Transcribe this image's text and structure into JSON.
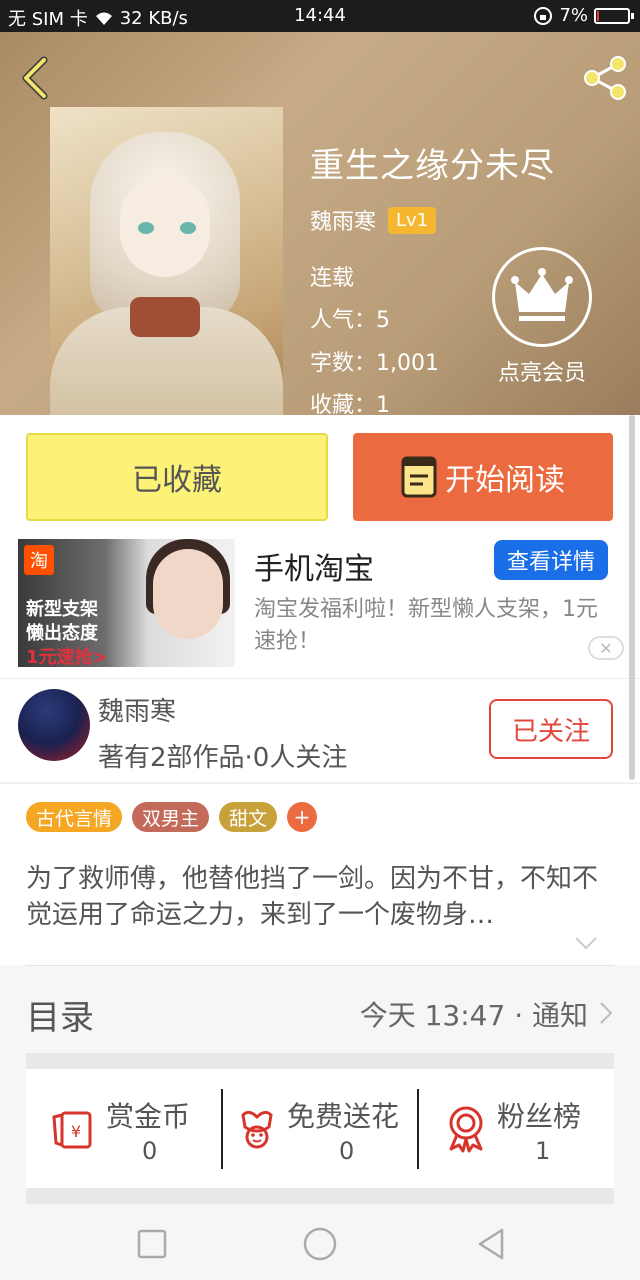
{
  "status_bar": {
    "carrier": "无 SIM 卡",
    "speed": "32 KB/s",
    "time": "14:44",
    "battery": "7%",
    "battery_level": 0.07
  },
  "book": {
    "title": "重生之缘分未尽",
    "author": "魏雨寒",
    "level": "Lv1",
    "status": "连载",
    "popularity": "人气：5",
    "word_count": "字数：1,001",
    "favorites": "收藏：1"
  },
  "vip": {
    "label": "点亮会员"
  },
  "actions": {
    "favorited_label": "已收藏",
    "read_label": "开始阅读"
  },
  "ad": {
    "title": "手机淘宝",
    "detail_button": "查看详情",
    "description": "淘宝发福利啦！新型懒人支架，1元速抢！",
    "image_logo": "淘",
    "image_text_1": "新型支架",
    "image_text_2": "懒出态度",
    "image_text_3": "1元速抢>"
  },
  "author_card": {
    "name": "魏雨寒",
    "info": "著有2部作品·0人关注",
    "follow_label": "已关注"
  },
  "tags": [
    {
      "label": "古代言情",
      "color": "#f5a623"
    },
    {
      "label": "双男主",
      "color": "#c46a5b"
    },
    {
      "label": "甜文",
      "color": "#c9a13b"
    }
  ],
  "tag_add": "+",
  "intro": "为了救师傅，他替他挡了一剑。因为不甘，不知不觉运用了命运之力，来到了一个废物身…",
  "catalog": {
    "title": "目录",
    "update": "今天 13:47 · 通知"
  },
  "stats": [
    {
      "label": "赏金币",
      "value": "0"
    },
    {
      "label": "免费送花",
      "value": "0"
    },
    {
      "label": "粉丝榜",
      "value": "1"
    }
  ],
  "colors": {
    "accent_orange": "#ec6a3f",
    "favorited_yellow": "#fdf278",
    "follow_red": "#e2473d",
    "detail_blue": "#1a6ee8",
    "icon_red": "#d9342b"
  }
}
